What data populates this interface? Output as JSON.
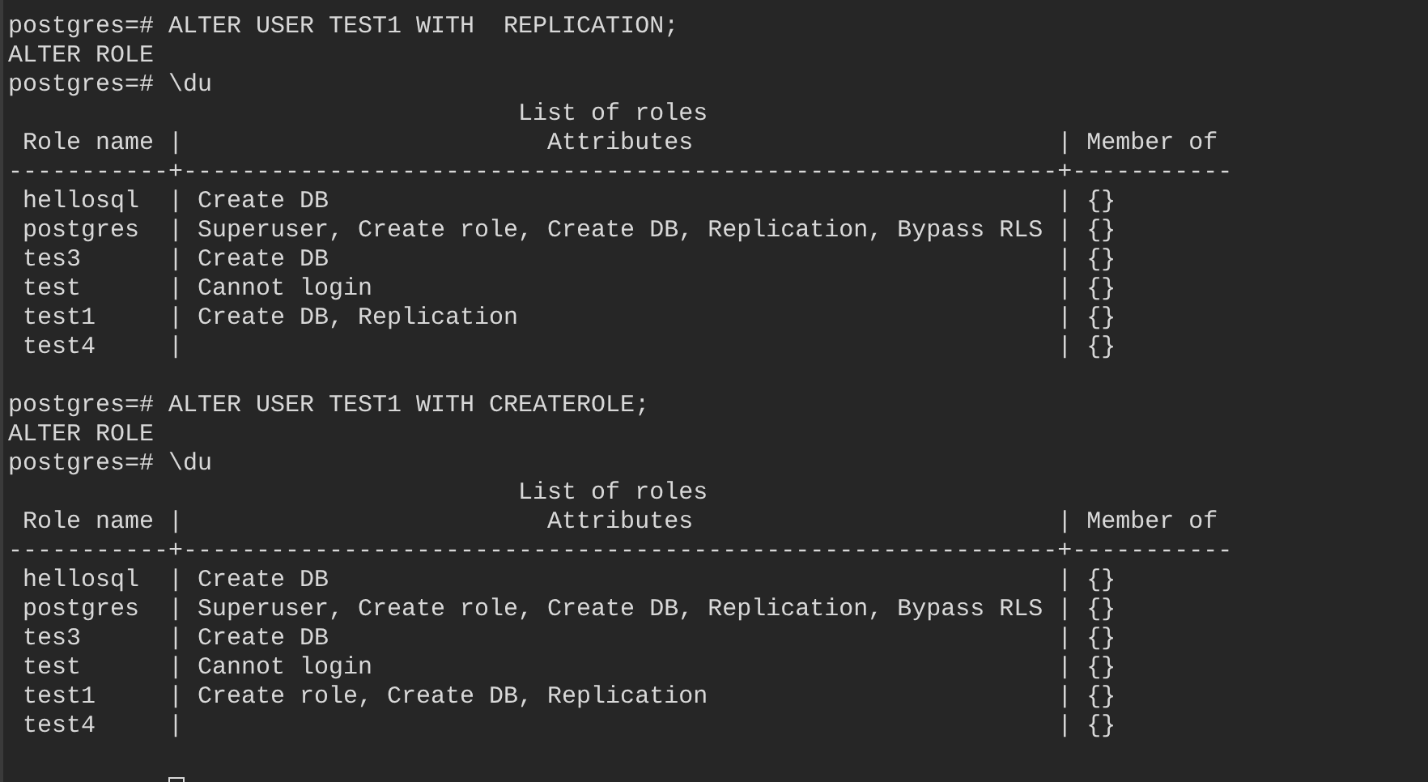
{
  "terminal": {
    "blocks": [
      {
        "lines": [
          "postgres=# ALTER USER TEST1 WITH  REPLICATION;",
          "ALTER ROLE",
          "postgres=# \\du",
          "                                   List of roles",
          " Role name |                         Attributes                         | Member of",
          "-----------+------------------------------------------------------------+-----------",
          " hellosql  | Create DB                                                  | {}",
          " postgres  | Superuser, Create role, Create DB, Replication, Bypass RLS | {}",
          " tes3      | Create DB                                                  | {}",
          " test      | Cannot login                                               | {}",
          " test1     | Create DB, Replication                                     | {}",
          " test4     |                                                            | {}"
        ]
      },
      {
        "lines": [
          "postgres=# ALTER USER TEST1 WITH CREATEROLE;",
          "ALTER ROLE",
          "postgres=# \\du",
          "                                   List of roles",
          " Role name |                         Attributes                         | Member of",
          "-----------+------------------------------------------------------------+-----------",
          " hellosql  | Create DB                                                  | {}",
          " postgres  | Superuser, Create role, Create DB, Replication, Bypass RLS | {}",
          " tes3      | Create DB                                                  | {}",
          " test      | Cannot login                                               | {}",
          " test1     | Create role, Create DB, Replication                        | {}",
          " test4     |                                                            | {}"
        ]
      }
    ]
  }
}
